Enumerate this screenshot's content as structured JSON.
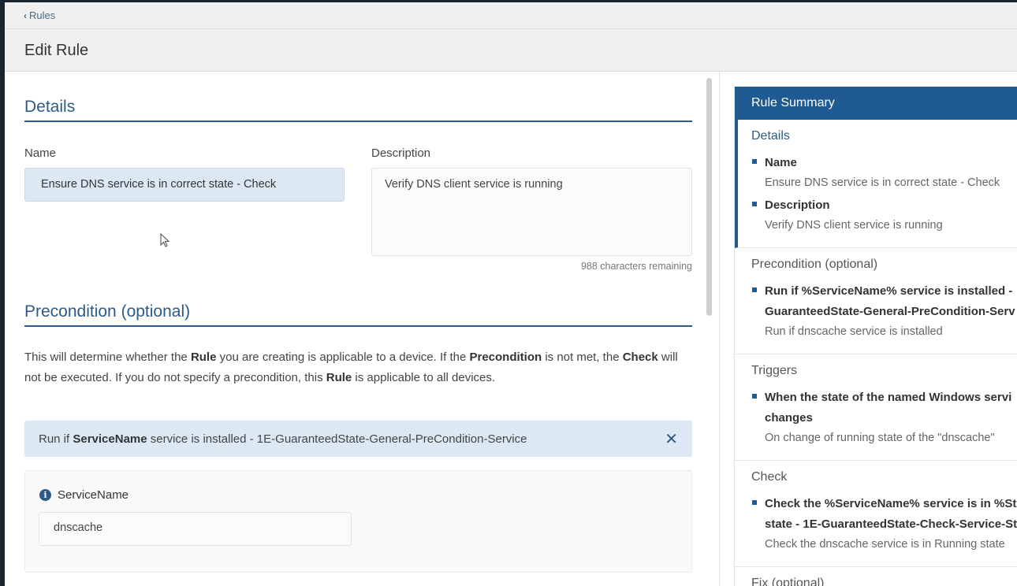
{
  "breadcrumb": {
    "back_label": "Rules"
  },
  "page": {
    "title": "Edit Rule"
  },
  "details": {
    "title": "Details",
    "name_label": "Name",
    "name_value": "Ensure DNS service is in correct state - Check",
    "description_label": "Description",
    "description_value": "Verify DNS client service is running",
    "chars_remaining": "988 characters remaining"
  },
  "precondition": {
    "title": "Precondition (optional)",
    "intro": {
      "t1": "This will determine whether the ",
      "b1": "Rule",
      "t2": " you are creating is applicable to a device. If the ",
      "b2": "Precondition",
      "t3": " is not met, the ",
      "b3": "Check",
      "t4": " will not be executed. If you do not specify a precondition, this ",
      "b4": "Rule",
      "t5": " is applicable to all devices."
    },
    "selected": {
      "prefix": "Run if ",
      "param": "ServiceName",
      "suffix": " service is installed - 1E-GuaranteedState-General-PreCondition-Service"
    },
    "param_label": "ServiceName",
    "param_value": "dnscache"
  },
  "summary": {
    "header": "Rule Summary",
    "sections": [
      {
        "title": "Details",
        "items": [
          {
            "title": "Name",
            "desc": "Ensure DNS service is in correct state - Check"
          },
          {
            "title": "Description",
            "desc": "Verify DNS client service is running"
          }
        ]
      },
      {
        "title": "Precondition (optional)",
        "items": [
          {
            "title1": "Run if %ServiceName% service is installed -",
            "title2": "GuaranteedState-General-PreCondition-Serv",
            "desc": "Run if dnscache service is installed"
          }
        ]
      },
      {
        "title": "Triggers",
        "items": [
          {
            "title1": "When the state of the named Windows servi",
            "title2": "changes",
            "desc": "On change of running state of the \"dnscache\""
          }
        ]
      },
      {
        "title": "Check",
        "items": [
          {
            "title1": "Check the %ServiceName% service is in %Sta",
            "title2": "state - 1E-GuaranteedState-Check-Service-St",
            "desc": "Check the dnscache service is in Running state"
          }
        ]
      },
      {
        "title": "Fix (optional)"
      }
    ]
  },
  "colors": {
    "accent": "#1f5a92",
    "heading": "#2d5a86",
    "selected_bg": "#dce9f5"
  }
}
